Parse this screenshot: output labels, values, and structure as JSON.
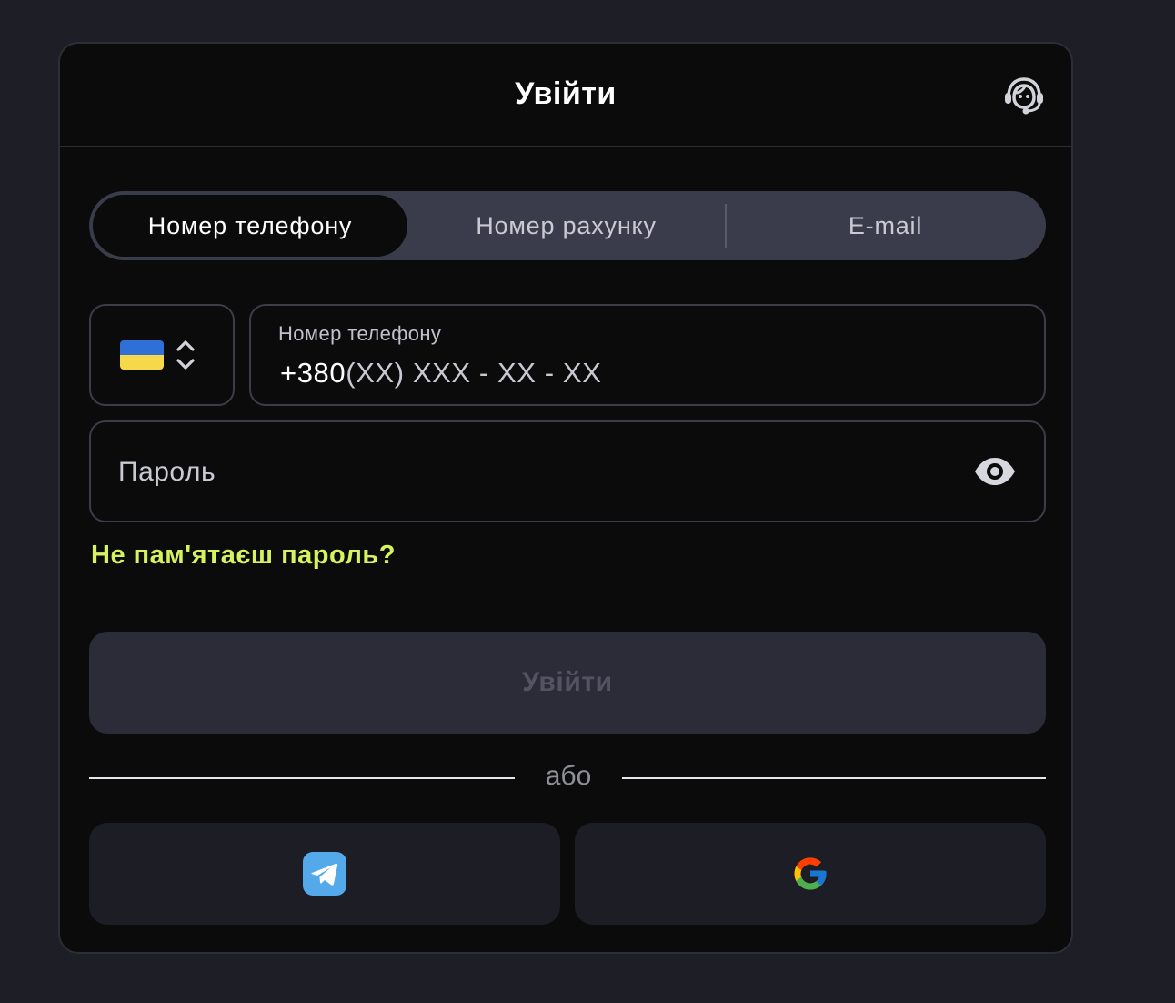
{
  "header": {
    "title": "Увійти",
    "support_icon": "support-headset-icon"
  },
  "tabs": [
    {
      "label": "Номер телефону",
      "active": true
    },
    {
      "label": "Номер рахунку",
      "active": false
    },
    {
      "label": "E-mail",
      "active": false
    }
  ],
  "country": {
    "flag_icon": "ukraine-flag-icon",
    "selector_icon": "chevron-up-down-icon"
  },
  "phone": {
    "label": "Номер телефону",
    "prefix": "+380",
    "mask": "(XX) XXX - XX - XX"
  },
  "password": {
    "placeholder": "Пароль",
    "toggle_icon": "eye-icon"
  },
  "forgot_password": "Не пам'ятаєш пароль?",
  "submit_label": "Увійти",
  "divider_text": "або",
  "social": [
    {
      "name": "Telegram",
      "icon": "telegram-icon"
    },
    {
      "name": "Google",
      "icon": "google-icon"
    }
  ],
  "colors": {
    "background": "#1e1f26",
    "modal": "#0b0b0c",
    "accent": "#d6f25f",
    "tab_bar": "#3a3c4b",
    "button_disabled": "#2b2c37",
    "social_button": "#1d1e25"
  }
}
